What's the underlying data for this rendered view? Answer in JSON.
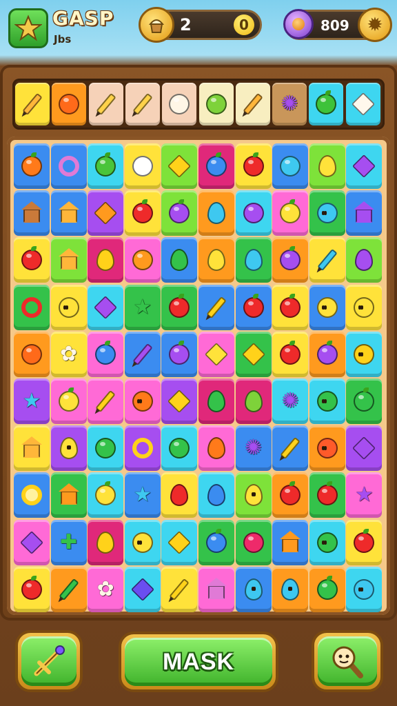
{
  "header": {
    "brand_title": "GASP",
    "brand_subtitle": "Jbs",
    "coins_value": "2",
    "coins_badge": "0",
    "gems_value": "809"
  },
  "colors": {
    "red": "#ff4a4a",
    "orange": "#ff9a1e",
    "yellow": "#ffe23a",
    "lime": "#7ee23a",
    "green": "#34c24a",
    "cyan": "#3ed6f0",
    "blue": "#3b8cf0",
    "purple": "#a64ef0",
    "pink": "#ff6ad6",
    "magenta": "#e0287a",
    "peach": "#f6d2b8",
    "cream": "#f8eec0",
    "brown": "#c9965a",
    "teal": "#34c2b8"
  },
  "tray": [
    {
      "bg": "yellow",
      "icon": "pencil-icon",
      "ic": "#ffb63a"
    },
    {
      "bg": "orange",
      "icon": "fruit-icon",
      "ic": "#ff6a1a"
    },
    {
      "bg": "peach",
      "icon": "pencil-icon",
      "ic": "#ffd24a"
    },
    {
      "bg": "peach",
      "icon": "pencil-icon",
      "ic": "#ffd24a"
    },
    {
      "bg": "peach",
      "icon": "garlic-icon",
      "ic": "#fff6e6"
    },
    {
      "bg": "cream",
      "icon": "leaf-icon",
      "ic": "#7ed23a"
    },
    {
      "bg": "cream",
      "icon": "pencil-icon",
      "ic": "#ffb63a"
    },
    {
      "bg": "brown",
      "icon": "gear-icon",
      "ic": "#a64ef0"
    },
    {
      "bg": "cyan",
      "icon": "apple-icon",
      "ic": "#3ec23a"
    },
    {
      "bg": "cyan",
      "icon": "card-icon",
      "ic": "#fff8ec"
    }
  ],
  "grid": [
    [
      [
        "blue",
        "orange-fruit-icon",
        "#ff7a1a"
      ],
      [
        "blue",
        "ring-icon",
        "#e07ad6"
      ],
      [
        "cyan",
        "apple-icon",
        "#4ac43a"
      ],
      [
        "yellow",
        "cake-icon",
        "#ffffff"
      ],
      [
        "lime",
        "cube-icon",
        "#ffd21a"
      ],
      [
        "magenta",
        "berry-icon",
        "#3b8cf0"
      ],
      [
        "yellow",
        "apple-icon",
        "#ee2a2a"
      ],
      [
        "blue",
        "fish-icon",
        "#3ec8f0"
      ],
      [
        "lime",
        "lemon-icon",
        "#ffe23a"
      ],
      [
        "cyan",
        "cube-icon",
        "#a64ef0"
      ]
    ],
    [
      [
        "blue",
        "basket-icon",
        "#c97a3a"
      ],
      [
        "blue",
        "jar-icon",
        "#ffb63a"
      ],
      [
        "purple",
        "cube-icon",
        "#ff9a1e"
      ],
      [
        "yellow",
        "strawberry-icon",
        "#ee2a2a"
      ],
      [
        "lime",
        "grape-icon",
        "#a64ef0"
      ],
      [
        "orange",
        "drop-icon",
        "#3ec8f0"
      ],
      [
        "cyan",
        "bottle-icon",
        "#a64ef0"
      ],
      [
        "pink",
        "apple-icon",
        "#ffe23a"
      ],
      [
        "green",
        "face-icon",
        "#3ec8f0"
      ],
      [
        "blue",
        "robot-icon",
        "#a64ef0"
      ]
    ],
    [
      [
        "yellow",
        "apple-icon",
        "#ee2a2a"
      ],
      [
        "lime",
        "house-icon",
        "#ffb63a"
      ],
      [
        "magenta",
        "bean-icon",
        "#ffd21a"
      ],
      [
        "pink",
        "candy-icon",
        "#ff9a1e"
      ],
      [
        "blue",
        "pepper-icon",
        "#34c24a"
      ],
      [
        "orange",
        "lemon-icon",
        "#ffe23a"
      ],
      [
        "green",
        "eggplant-icon",
        "#3ec8f0"
      ],
      [
        "orange",
        "plum-icon",
        "#a64ef0"
      ],
      [
        "yellow",
        "pencil-icon",
        "#3ec8f0"
      ],
      [
        "lime",
        "eggplant-icon",
        "#a64ef0"
      ]
    ],
    [
      [
        "green",
        "ring-icon",
        "#ee2a2a"
      ],
      [
        "yellow",
        "pineapple-face-icon",
        "#ffe23a"
      ],
      [
        "cyan",
        "cube-icon",
        "#a64ef0"
      ],
      [
        "green",
        "star-icon",
        "#34c24a"
      ],
      [
        "green",
        "apple-icon",
        "#ee2a2a"
      ],
      [
        "blue",
        "pencil-icon",
        "#ffd21a"
      ],
      [
        "blue",
        "apple-icon",
        "#ee2a2a"
      ],
      [
        "yellow",
        "apple-icon",
        "#ee2a2a"
      ],
      [
        "blue",
        "face-icon",
        "#ffe23a"
      ],
      [
        "yellow",
        "face-icon",
        "#ffe23a"
      ]
    ],
    [
      [
        "orange",
        "fruit-icon",
        "#ff6a1a"
      ],
      [
        "yellow",
        "flower-icon",
        "#fff6e6"
      ],
      [
        "pink",
        "berry-icon",
        "#3b8cf0"
      ],
      [
        "blue",
        "pencil-icon",
        "#a64ef0"
      ],
      [
        "blue",
        "plum-icon",
        "#a64ef0"
      ],
      [
        "pink",
        "cube-icon",
        "#ffe23a"
      ],
      [
        "green",
        "cube-icon",
        "#ffd21a"
      ],
      [
        "yellow",
        "apple-icon",
        "#ee2a2a"
      ],
      [
        "orange",
        "plum-icon",
        "#a64ef0"
      ],
      [
        "cyan",
        "face-icon",
        "#ffd21a"
      ]
    ],
    [
      [
        "purple",
        "star-icon",
        "#3ec8f0"
      ],
      [
        "pink",
        "apple-icon",
        "#ffe23a"
      ],
      [
        "pink",
        "pencil-icon",
        "#ffd21a"
      ],
      [
        "pink",
        "orange-face-icon",
        "#ff7a1a"
      ],
      [
        "purple",
        "cube-icon",
        "#ffd21a"
      ],
      [
        "magenta",
        "pepper-icon",
        "#34c24a"
      ],
      [
        "magenta",
        "pepper-icon",
        "#7ed23a"
      ],
      [
        "cyan",
        "gear-icon",
        "#a64ef0"
      ],
      [
        "cyan",
        "face-icon",
        "#34c24a"
      ],
      [
        "green",
        "apple-icon",
        "#34c24a"
      ]
    ],
    [
      [
        "yellow",
        "jar-icon",
        "#ffb63a"
      ],
      [
        "purple",
        "drop-face-icon",
        "#ffe23a"
      ],
      [
        "cyan",
        "leaf-icon",
        "#34c24a"
      ],
      [
        "purple",
        "ring-icon",
        "#ffd21a"
      ],
      [
        "cyan",
        "leaf-icon",
        "#34c24a"
      ],
      [
        "pink",
        "drop-icon",
        "#ff7a1a"
      ],
      [
        "blue",
        "gear-icon",
        "#a64ef0"
      ],
      [
        "blue",
        "pencil-icon",
        "#ffd21a"
      ],
      [
        "orange",
        "apple-face-icon",
        "#ff5a2a"
      ],
      [
        "purple",
        "card-icon",
        "#a64ef0"
      ]
    ],
    [
      [
        "blue",
        "coin-icon",
        "#ffd21a"
      ],
      [
        "green",
        "house-icon",
        "#ff9a1e"
      ],
      [
        "cyan",
        "apple-icon",
        "#ffe23a"
      ],
      [
        "blue",
        "star-icon",
        "#3ec8f0"
      ],
      [
        "yellow",
        "drop-icon",
        "#ee2a2a"
      ],
      [
        "cyan",
        "drop-icon",
        "#3b8cf0"
      ],
      [
        "lime",
        "pepper-face-icon",
        "#ffe23a"
      ],
      [
        "orange",
        "apple-icon",
        "#ee2a2a"
      ],
      [
        "green",
        "strawberry-icon",
        "#ee2a2a"
      ],
      [
        "pink",
        "star-icon",
        "#a64ef0"
      ]
    ],
    [
      [
        "pink",
        "cube-icon",
        "#a64ef0"
      ],
      [
        "blue",
        "cross-icon",
        "#34c24a"
      ],
      [
        "magenta",
        "bean-icon",
        "#ffd21a"
      ],
      [
        "cyan",
        "face-icon",
        "#ffe23a"
      ],
      [
        "cyan",
        "cube-icon",
        "#ffd21a"
      ],
      [
        "green",
        "berry-icon",
        "#3b8cf0"
      ],
      [
        "green",
        "heart-icon",
        "#ee2a6a"
      ],
      [
        "blue",
        "jar-icon",
        "#ff9a1e"
      ],
      [
        "cyan",
        "face-icon",
        "#34c24a"
      ],
      [
        "yellow",
        "apple-icon",
        "#ee2a2a"
      ]
    ],
    [
      [
        "yellow",
        "strawberry-icon",
        "#ee2a2a"
      ],
      [
        "orange",
        "pencil-icon",
        "#34c24a"
      ],
      [
        "pink",
        "flower-icon",
        "#fff6e6"
      ],
      [
        "cyan",
        "cube-icon",
        "#6a4ef0"
      ],
      [
        "yellow",
        "pencil-icon",
        "#ffd21a"
      ],
      [
        "pink",
        "robot-icon",
        "#e07ad6"
      ],
      [
        "blue",
        "drop-face-icon",
        "#3ec8f0"
      ],
      [
        "orange",
        "drop-face-icon",
        "#3ec8f0"
      ],
      [
        "orange",
        "apple-icon",
        "#34c24a"
      ],
      [
        "cyan",
        "face-icon",
        "#3ec8f0"
      ]
    ]
  ],
  "buttons": {
    "left_icon": "sword-icon",
    "mask_label": "MASK",
    "right_icon": "magnifier-icon"
  }
}
